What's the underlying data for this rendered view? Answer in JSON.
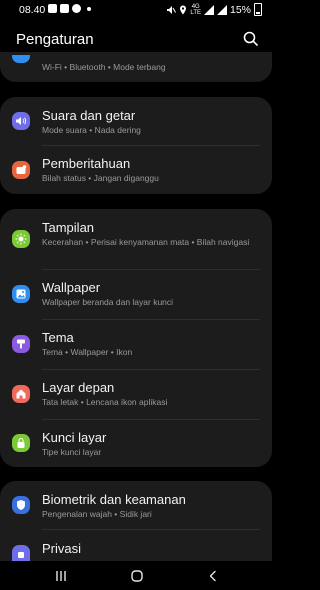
{
  "status_bar": {
    "time": "08.40",
    "battery": "15%",
    "network_top": "4G",
    "network_bottom": "LTE"
  },
  "header": {
    "title": "Pengaturan"
  },
  "partial_item": {
    "subtitle": "Wi-Fi  •  Bluetooth  •  Mode terbang"
  },
  "items": [
    {
      "title": "Suara dan getar",
      "subtitle": "Mode suara  •  Nada dering",
      "color": "#6f6de8"
    },
    {
      "title": "Pemberitahuan",
      "subtitle": "Bilah status  •  Jangan diganggu",
      "color": "#e8663f"
    },
    {
      "title": "Tampilan",
      "subtitle": "Kecerahan  •  Perisai kenyamanan mata  •  Bilah navigasi",
      "color": "#7cc936"
    },
    {
      "title": "Wallpaper",
      "subtitle": "Wallpaper beranda dan layar kunci",
      "color": "#2f8ef0"
    },
    {
      "title": "Tema",
      "subtitle": "Tema  •  Wallpaper  •  Ikon",
      "color": "#8a5be0"
    },
    {
      "title": "Layar depan",
      "subtitle": "Tata letak  •  Lencana ikon aplikasi",
      "color": "#f06a5c"
    },
    {
      "title": "Kunci layar",
      "subtitle": "Tipe kunci layar",
      "color": "#7cc936"
    },
    {
      "title": "Biometrik dan keamanan",
      "subtitle": "Pengenalan wajah  •  Sidik jari",
      "color": "#3a6fe0"
    },
    {
      "title": "Privasi",
      "subtitle": "",
      "color": "#6f6de8"
    }
  ]
}
